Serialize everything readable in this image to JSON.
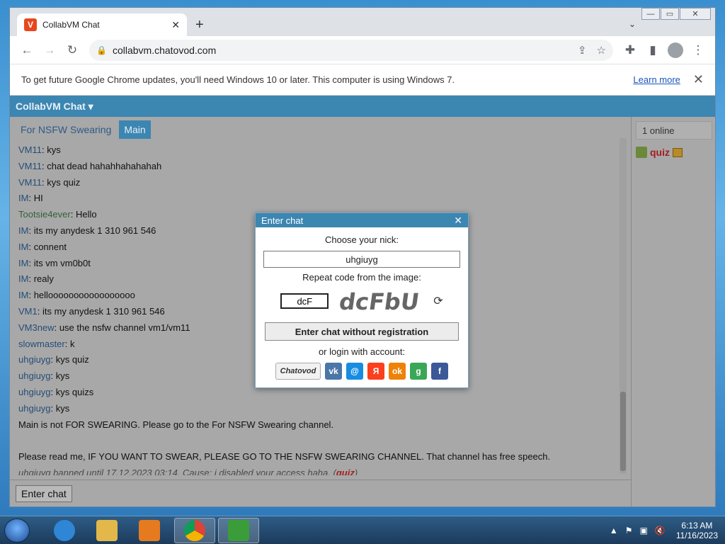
{
  "browser": {
    "tab_title": "CollabVM Chat",
    "tab_favicon": "V",
    "url": "collabvm.chatovod.com",
    "window_buttons": {
      "minimize": "—",
      "maximize": "▭",
      "close": "✕"
    }
  },
  "infobar": {
    "message": "To get future Google Chrome updates, you'll need Windows 10 or later. This computer is using Windows 7.",
    "link": "Learn more"
  },
  "site": {
    "title": "CollabVM Chat ▾",
    "channels": [
      "For NSFW Swearing",
      "Main"
    ],
    "enter_chat_button": "Enter chat"
  },
  "messages": [
    {
      "nick": "VM11",
      "text": "kys"
    },
    {
      "nick": "VM11",
      "text": "chat dead hahahhahahahah"
    },
    {
      "nick": "VM11",
      "text": "kys quiz"
    },
    {
      "nick": "IM",
      "text": "HI"
    },
    {
      "nick": "Tootsie4ever",
      "text": "Hello",
      "green": true
    },
    {
      "nick": "IM",
      "text": "its my anydesk 1 310 961 546"
    },
    {
      "nick": "IM",
      "text": "connent"
    },
    {
      "nick": "IM",
      "text": "its vm vm0b0t"
    },
    {
      "nick": "IM",
      "text": "realy"
    },
    {
      "nick": "IM",
      "text": "hellooooooooooooooooo"
    },
    {
      "nick": "VM1",
      "text": "its my anydesk 1 310 961 546"
    },
    {
      "nick": "VM3new",
      "text": "use the nsfw channel vm1/vm11"
    },
    {
      "nick": "slowmaster",
      "text": "k"
    },
    {
      "nick": "uhgiuyg",
      "text": "kys quiz"
    },
    {
      "nick": "uhgiuyg",
      "text": "kys"
    },
    {
      "nick": "uhgiuyg",
      "text": "kys quizs"
    },
    {
      "nick": "uhgiuyg",
      "text": "kys"
    }
  ],
  "system_messages": {
    "line1": "Main is not FOR SWEARING. Please go to the For NSFW Swearing channel.",
    "line2": "Please read me, IF YOU WANT TO SWEAR, PLEASE GO TO THE NSFW SWEARING CHANNEL. That channel has free speech.",
    "banned_text": "uhgiuyg banned until 17.12.2023 03:14. Cause: i disabled your access haha. (",
    "banned_by": "quiz",
    "banned_close": ")"
  },
  "sidebar": {
    "online_count": "1 online",
    "user": "quiz"
  },
  "modal": {
    "title": "Enter chat",
    "nick_label": "Choose your nick:",
    "nick_value": "uhgiuyg",
    "captcha_label": "Repeat code from the image:",
    "captcha_value": "dcF",
    "captcha_image_text": "dcFbU",
    "register_button": "Enter chat without registration",
    "login_label": "or login with account:",
    "social": [
      {
        "name": "Chatovod",
        "label": "Chatovod",
        "color": "#f2f2f2"
      },
      {
        "name": "vk",
        "label": "vk",
        "color": "#4a76a8"
      },
      {
        "name": "mailru",
        "label": "@",
        "color": "#168de2"
      },
      {
        "name": "yandex",
        "label": "Я",
        "color": "#fc3f1d"
      },
      {
        "name": "odnoklassniki",
        "label": "ok",
        "color": "#ee8208"
      },
      {
        "name": "google",
        "label": "g",
        "color": "#3aa757"
      },
      {
        "name": "facebook",
        "label": "f",
        "color": "#3b5998"
      }
    ]
  },
  "taskbar": {
    "time": "6:13 AM",
    "date": "11/16/2023"
  }
}
